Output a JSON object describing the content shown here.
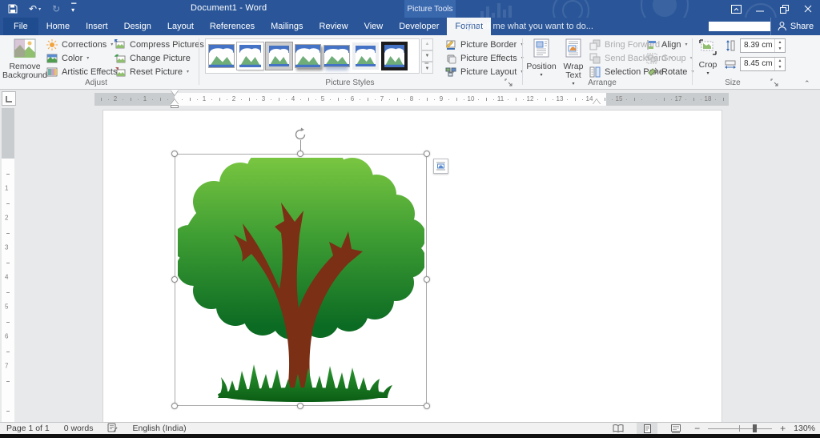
{
  "titlebar": {
    "title": "Document1 - Word",
    "contextual_label": "Picture Tools"
  },
  "tabs": [
    {
      "id": "file",
      "label": "File",
      "state": "file"
    },
    {
      "id": "home",
      "label": "Home"
    },
    {
      "id": "insert",
      "label": "Insert"
    },
    {
      "id": "design",
      "label": "Design"
    },
    {
      "id": "layout",
      "label": "Layout"
    },
    {
      "id": "references",
      "label": "References"
    },
    {
      "id": "mailings",
      "label": "Mailings"
    },
    {
      "id": "review",
      "label": "Review"
    },
    {
      "id": "view",
      "label": "View"
    },
    {
      "id": "developer",
      "label": "Developer"
    },
    {
      "id": "format",
      "label": "Format",
      "state": "active"
    }
  ],
  "tellme": {
    "text": "Tell me what you want to do..."
  },
  "share": {
    "label": "Share"
  },
  "ribbon": {
    "adjust": {
      "label": "Adjust",
      "remove_background": "Remove Background",
      "corrections": "Corrections",
      "color": "Color",
      "artistic_effects": "Artistic Effects",
      "compress": "Compress Pictures",
      "change": "Change Picture",
      "reset": "Reset Picture"
    },
    "picture_styles": {
      "label": "Picture Styles",
      "styles": [
        {
          "id": "simple-frame"
        },
        {
          "id": "simple-white-frame"
        },
        {
          "id": "metal-frame"
        },
        {
          "id": "drop-shadow"
        },
        {
          "id": "reflection"
        },
        {
          "id": "soft-edge"
        },
        {
          "id": "black-frame"
        }
      ],
      "border": "Picture Border",
      "effects": "Picture Effects",
      "layout": "Picture Layout"
    },
    "arrange": {
      "label": "Arrange",
      "position": "Position",
      "wrap_text": "Wrap Text",
      "bring_forward": "Bring Forward",
      "send_backward": "Send Backward",
      "selection_pane": "Selection Pane",
      "align": "Align",
      "group": "Group",
      "rotate": "Rotate"
    },
    "size": {
      "label": "Size",
      "crop": "Crop",
      "height": "8.39 cm",
      "width": "8.45 cm"
    }
  },
  "ruler": {
    "h_left": [
      "2",
      "1"
    ],
    "h_main": [
      "1",
      "2",
      "3",
      "4",
      "5",
      "6",
      "7",
      "8",
      "9",
      "10",
      "11",
      "12",
      "13",
      "14",
      "15"
    ],
    "h_right": [
      "17",
      "18"
    ],
    "v_main": [
      "1",
      "2",
      "3",
      "4",
      "5",
      "6",
      "7"
    ]
  },
  "statusbar": {
    "page": "Page 1 of 1",
    "words": "0 words",
    "language": "English (India)",
    "zoom": "130%"
  },
  "colors": {
    "accent": "#2b579a",
    "titlebar": "#2a5699",
    "contextual_tab": "#3a68ad",
    "tree_green_light": "#76c440",
    "tree_green_dark": "#0c6b23",
    "trunk_brown": "#7b2f15",
    "grass_green": "#156b1d"
  }
}
